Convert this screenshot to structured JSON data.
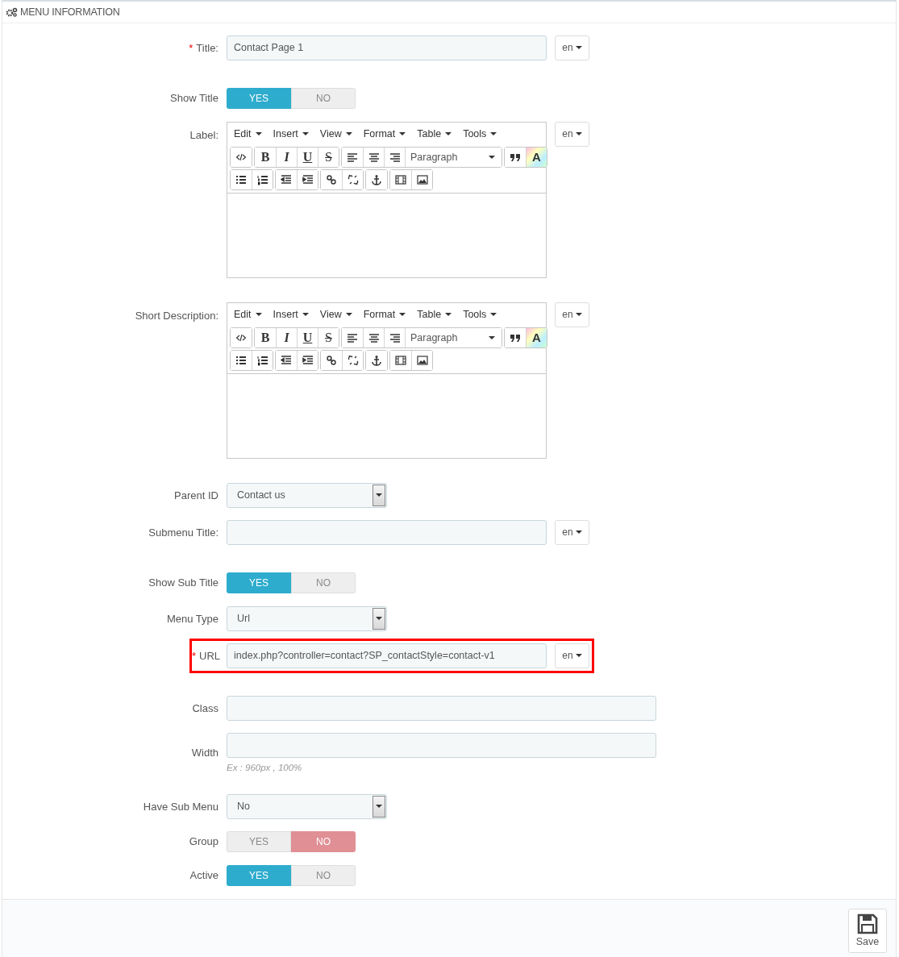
{
  "panel": {
    "title": "MENU INFORMATION"
  },
  "fields": [
    {
      "kind": "text",
      "label": "Title:",
      "required_mark": "*",
      "highlighted": false,
      "value": "Contact Page 1",
      "lang": "en"
    },
    {
      "kind": "toggle",
      "label": "Show Title",
      "highlighted": false,
      "options": [
        {
          "label": "YES",
          "selected": true
        },
        {
          "label": "NO",
          "selected": false
        }
      ]
    },
    {
      "kind": "editor",
      "label": "Label:",
      "highlighted": false,
      "lang": "en",
      "menus": [
        "Edit",
        "Insert",
        "View",
        "Format",
        "Table",
        "Tools"
      ],
      "format_buttons": [
        "B",
        "I",
        "U",
        "S"
      ],
      "block_format": "Paragraph",
      "color_button": "A"
    },
    {
      "kind": "editor",
      "label": "Short Description:",
      "highlighted": false,
      "lang": "en",
      "menus": [
        "Edit",
        "Insert",
        "View",
        "Format",
        "Table",
        "Tools"
      ],
      "format_buttons": [
        "B",
        "I",
        "U",
        "S"
      ],
      "block_format": "Paragraph",
      "color_button": "A"
    },
    {
      "kind": "select",
      "label": "Parent ID",
      "highlighted": false,
      "value": "Contact us"
    },
    {
      "kind": "text",
      "label": "Submenu Title:",
      "highlighted": false,
      "lang": "en"
    },
    {
      "kind": "toggle",
      "label": "Show Sub Title",
      "highlighted": false,
      "options": [
        {
          "label": "YES",
          "selected": true
        },
        {
          "label": "NO",
          "selected": false
        }
      ]
    },
    {
      "kind": "select",
      "label": "Menu Type",
      "highlighted": false,
      "value": "Url"
    },
    {
      "kind": "text",
      "label": "URL",
      "required_mark": "*",
      "highlighted": true,
      "value": "index.php?controller=contact?SP_contactStyle=contact-v1",
      "lang": "en"
    },
    {
      "kind": "text",
      "label": "Class",
      "highlighted": false
    },
    {
      "kind": "text",
      "label": "Width",
      "highlighted": false,
      "hint": "Ex : 960px , 100%"
    },
    {
      "kind": "select",
      "label": "Have Sub Menu",
      "highlighted": false,
      "value": "No"
    },
    {
      "kind": "toggle",
      "label": "Group",
      "highlighted": false,
      "options": [
        {
          "label": "YES",
          "selected": false
        },
        {
          "label": "NO",
          "selected": true
        }
      ]
    },
    {
      "kind": "toggle",
      "label": "Active",
      "highlighted": false,
      "options": [
        {
          "label": "YES",
          "selected": true
        },
        {
          "label": "NO",
          "selected": false
        }
      ]
    }
  ],
  "save_button": {
    "label": "Save"
  }
}
